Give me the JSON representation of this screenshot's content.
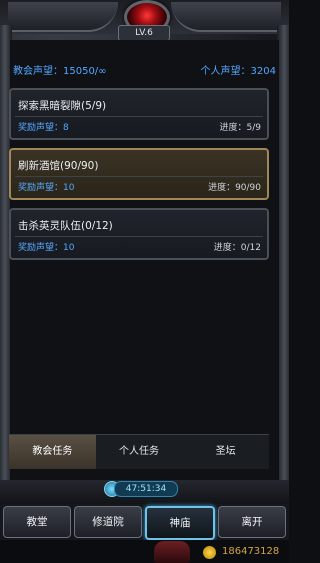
{
  "header": {
    "level": "LV.6"
  },
  "reputation": {
    "church_label": "教会声望：15050/∞",
    "personal_label": "个人声望：3204"
  },
  "quests": [
    {
      "title": "探索黑暗裂隙(5/9)",
      "reward": "奖励声望：8",
      "progress": "进度：5/9",
      "active": false
    },
    {
      "title": "刷新酒馆(90/90)",
      "reward": "奖励声望：10",
      "progress": "进度：90/90",
      "active": true
    },
    {
      "title": "击杀英灵队伍(0/12)",
      "reward": "奖励声望：10",
      "progress": "进度：0/12",
      "active": false
    }
  ],
  "tabs": [
    {
      "label": "教会任务",
      "active": true
    },
    {
      "label": "个人任务",
      "active": false
    },
    {
      "label": "圣坛",
      "active": false
    }
  ],
  "timer": "47:51:34",
  "nav": [
    {
      "label": "教堂",
      "active": false
    },
    {
      "label": "修道院",
      "active": false
    },
    {
      "label": "神庙",
      "active": true
    },
    {
      "label": "离开",
      "active": false
    }
  ],
  "coins": "186473128",
  "icons": {
    "gem": "red-gem-icon",
    "timer": "crystal-icon",
    "coin": "gold-coin-icon",
    "mask": "demon-mask-icon"
  }
}
